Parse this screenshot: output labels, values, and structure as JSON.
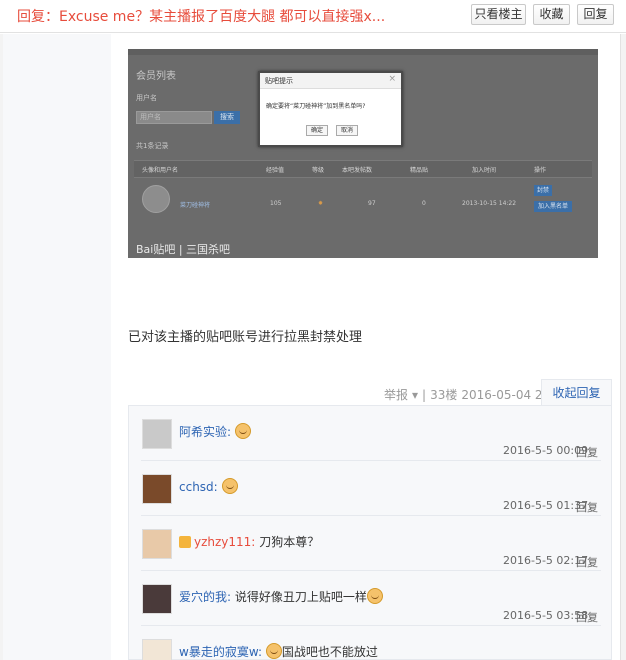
{
  "header": {
    "title": "回复：Excuse me？某主播报了百度大腿 都可以直接强x...",
    "buttons": {
      "only_author": "只看楼主",
      "favorite": "收藏",
      "reply": "回复"
    }
  },
  "embedded_screenshot": {
    "section_title": "会员列表",
    "username_label": "用户名",
    "username_placeholder": "用户名",
    "search_button": "搜索",
    "record_count": "共1条记录",
    "columns": [
      "头像和用户名",
      "经验值",
      "等级",
      "本吧发帖数",
      "精品贴",
      "加入时间",
      "操作"
    ],
    "row": {
      "username": "菜刀碰神将",
      "exp": "105",
      "posts": "97",
      "quality": "0",
      "joined": "2013-10-15 14:22",
      "actions": [
        "封禁",
        "加入黑名单"
      ]
    },
    "dialog": {
      "title": "贴吧提示",
      "message": "确定要将“菜刀碰神将”加到黑名单吗?",
      "ok": "确定",
      "cancel": "取消"
    },
    "watermark": "Bai贴吧 | 三国杀吧"
  },
  "post": {
    "text": "已对该主播的贴吧账号进行拉黑封禁处理",
    "meta": {
      "report": "举报",
      "floor": "33楼",
      "time": "2016-05-04 23:18"
    },
    "collapse_reply": "收起回复"
  },
  "comments": [
    {
      "user": "阿希实验:",
      "text": "",
      "emoji": true,
      "vip": false,
      "time": "2016-5-5 00:09",
      "reply": "回复"
    },
    {
      "user": "cchsd:",
      "text": "",
      "emoji": true,
      "vip": false,
      "time": "2016-5-5 01:37",
      "reply": "回复"
    },
    {
      "user": "yzhzy111:",
      "text": "刀狗本尊？",
      "emoji": false,
      "vip": true,
      "time": "2016-5-5 02:17",
      "reply": "回复"
    },
    {
      "user": "爱穴的我:",
      "text": "说得好像丑刀上贴吧一样",
      "emoji": true,
      "vip": false,
      "time": "2016-5-5 03:58",
      "reply": "回复"
    },
    {
      "user": "w暴走的寂寞w:",
      "text": "国战吧也不能放过",
      "emoji": true,
      "vip": false,
      "time": "",
      "reply": ""
    }
  ],
  "colors": {
    "title_red": "#e74c3c",
    "link_blue": "#2d64b3"
  }
}
